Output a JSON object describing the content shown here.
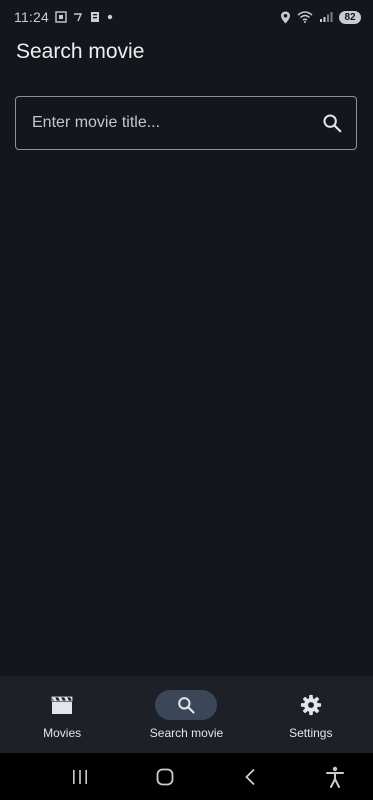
{
  "status_bar": {
    "time": "11:24",
    "battery": "82",
    "left_icons": [
      "screenshot-icon",
      "sim-icon",
      "clipboard-icon",
      "dot-icon"
    ],
    "right_icons": [
      "location-icon",
      "wifi-icon",
      "signal-icon"
    ]
  },
  "header": {
    "title": "Search movie"
  },
  "search": {
    "placeholder": "Enter movie title...",
    "value": ""
  },
  "bottom_nav": {
    "items": [
      {
        "label": "Movies",
        "icon": "clapperboard-icon",
        "active": false
      },
      {
        "label": "Search movie",
        "icon": "search-icon",
        "active": true
      },
      {
        "label": "Settings",
        "icon": "gear-icon",
        "active": false
      }
    ]
  },
  "system_nav": {
    "buttons": [
      "recent-apps-icon",
      "home-icon",
      "back-icon",
      "accessibility-icon"
    ]
  },
  "colors": {
    "background": "#13161b",
    "nav_background": "#1d2026",
    "active_pill": "#3b4758",
    "text": "#e3e5ea"
  }
}
